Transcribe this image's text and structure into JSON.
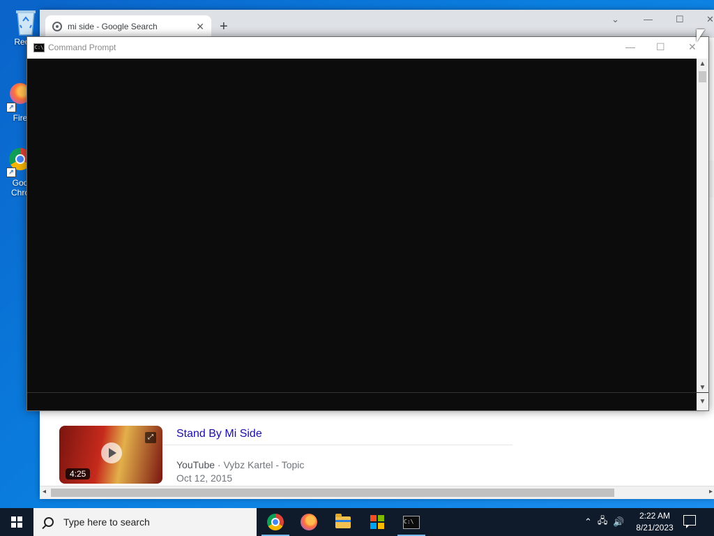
{
  "desktop": {
    "icons": [
      {
        "label": "Recyc"
      },
      {
        "label": "Fire"
      },
      {
        "label": "Goo Chro"
      }
    ]
  },
  "chrome": {
    "tab_title": "mi side - Google Search",
    "close_symbol": "✕",
    "newtab_symbol": "+",
    "result": {
      "duration": "4:25",
      "title": "Stand By Mi Side",
      "source": "YouTube",
      "separator": " · ",
      "channel": "Vybz Kartel - Topic",
      "date": "Oct 12, 2015"
    }
  },
  "cmd": {
    "title": "Command Prompt",
    "icon_text": "C:\\"
  },
  "taskbar": {
    "search_placeholder": "Type here to search",
    "time": "2:22 AM",
    "date": "8/21/2023"
  }
}
